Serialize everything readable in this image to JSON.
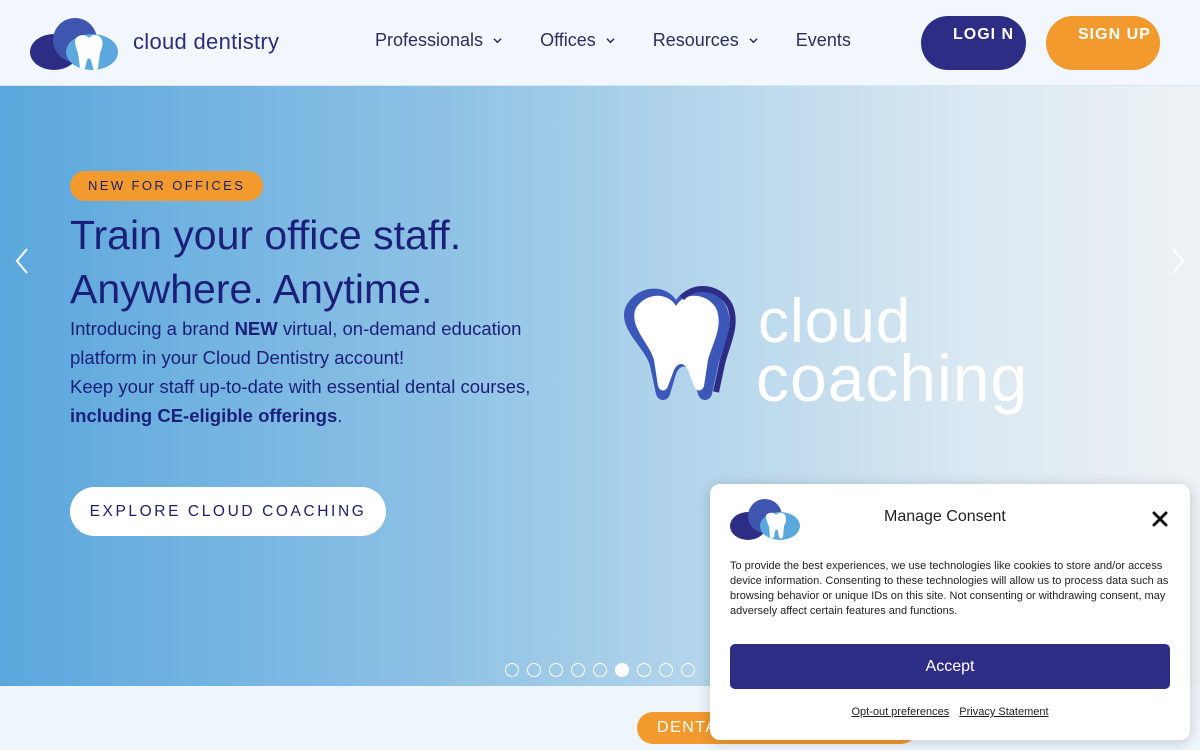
{
  "header": {
    "logo_text": "cloud dentistry",
    "nav": [
      {
        "label": "Professionals",
        "has_dropdown": true
      },
      {
        "label": "Offices",
        "has_dropdown": true
      },
      {
        "label": "Resources",
        "has_dropdown": true
      },
      {
        "label": "Events",
        "has_dropdown": false
      }
    ],
    "login_label": "LOGI N",
    "signup_label": "SIGN UP"
  },
  "hero": {
    "badge": "NEW FOR OFFICES",
    "headline_line1": "Train your office staff.",
    "headline_line2": "Anywhere. Anytime.",
    "desc_part1": "Introducing a brand ",
    "desc_bold1": "NEW",
    "desc_part2": " virtual, on-demand education platform in your Cloud Dentistry account!",
    "desc_part3": "Keep your staff up-to-date with essential dental courses, ",
    "desc_bold2": "including CE-eligible offerings",
    "desc_part4": ".",
    "cta_label": "EXPLORE CLOUD COACHING",
    "brand_line1": "cloud",
    "brand_line2": "coaching",
    "slide_count": 9,
    "active_slide": 6
  },
  "bottom": {
    "pill_label": "DENTA"
  },
  "consent": {
    "title": "Manage Consent",
    "body": "To provide the best experiences, we use technologies like cookies to store and/or access device information. Consenting to these technologies will allow us to process data such as browsing behavior or unique IDs on this site. Not consenting or withdrawing consent, may adversely affect certain features and functions.",
    "accept_label": "Accept",
    "optout_label": "Opt-out preferences",
    "privacy_label": "Privacy Statement"
  },
  "colors": {
    "brand_navy": "#2e2d86",
    "brand_orange": "#f29a2e",
    "hero_blue": "#5ba7dd"
  }
}
